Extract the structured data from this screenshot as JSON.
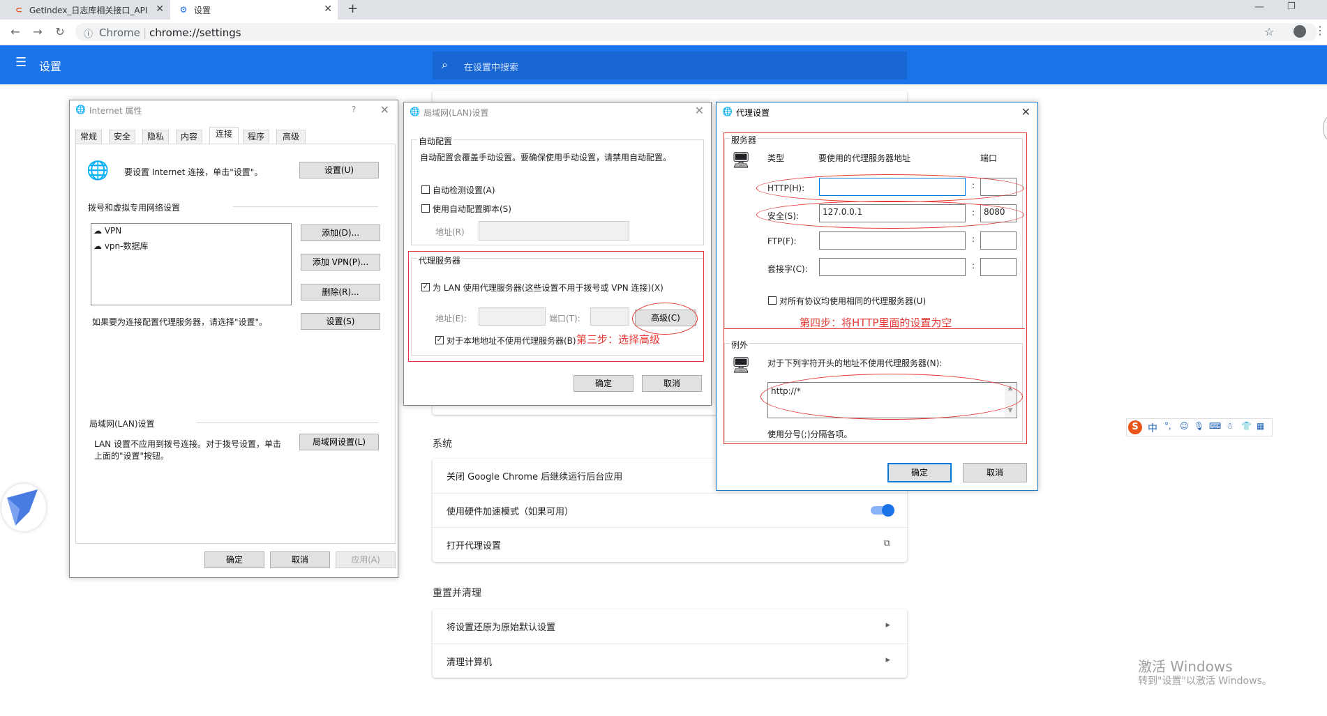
{
  "browser": {
    "tabs": [
      {
        "label": "GetIndex_日志库相关接口_API"
      },
      {
        "label": "设置"
      }
    ],
    "scheme_label": "Chrome",
    "url": "chrome://settings"
  },
  "settings": {
    "header_title": "设置",
    "search_placeholder": "在设置中搜索",
    "system_title": "系统",
    "system_items": [
      "关闭 Google Chrome 后继续运行后台应用",
      "使用硬件加速模式（如果可用）",
      "打开代理设置"
    ],
    "hw_accel_on": true,
    "reset_title": "重置并清理",
    "reset_items": [
      "将设置还原为原始默认设置",
      "清理计算机"
    ]
  },
  "inet": {
    "title": "Internet 属性",
    "help": "?",
    "tabs": [
      "常规",
      "安全",
      "隐私",
      "内容",
      "连接",
      "程序",
      "高级"
    ],
    "active_tab": "连接",
    "setup_text": "要设置 Internet 连接，单击\"设置\"。",
    "setup_btn": "设置(U)",
    "dialup_title": "拨号和虚拟专用网络设置",
    "connections": [
      "VPN",
      "vpn-数据库"
    ],
    "add_btn": "添加(D)...",
    "add_vpn_btn": "添加 VPN(P)...",
    "remove_btn": "删除(R)...",
    "settings_btn": "设置(S)",
    "proxy_hint": "如果要为连接配置代理服务器，请选择\"设置\"。",
    "lan_title": "局域网(LAN)设置",
    "lan_desc_1": "LAN 设置不应用到拨号连接。对于拨号设置，单击",
    "lan_desc_2": "上面的\"设置\"按钮。",
    "lan_btn": "局域网设置(L)",
    "ok": "确定",
    "cancel": "取消",
    "apply": "应用(A)"
  },
  "lan": {
    "title": "局域网(LAN)设置",
    "auto_title": "自动配置",
    "auto_desc": "自动配置会覆盖手动设置。要确保使用手动设置，请禁用自动配置。",
    "auto_detect": "自动检测设置(A)",
    "auto_script": "使用自动配置脚本(S)",
    "address_label": "地址(R)",
    "proxy_title": "代理服务器",
    "use_proxy": "为 LAN 使用代理服务器(这些设置不用于拨号或 VPN 连接)(X)",
    "addr_label": "地址(E):",
    "port_label": "端口(T):",
    "advanced_btn": "高级(C)",
    "bypass_local": "对于本地地址不使用代理服务器(B)",
    "step3": "第三步：选择高级",
    "ok": "确定",
    "cancel": "取消"
  },
  "proxy": {
    "title": "代理设置",
    "servers_title": "服务器",
    "col_type": "类型",
    "col_addr": "要使用的代理服务器地址",
    "col_port": "端口",
    "rows": [
      {
        "label": "HTTP(H):",
        "addr": "",
        "port": ""
      },
      {
        "label": "安全(S):",
        "addr": "127.0.0.1",
        "port": "8080"
      },
      {
        "label": "FTP(F):",
        "addr": "",
        "port": ""
      },
      {
        "label": "套接字(C):",
        "addr": "",
        "port": ""
      }
    ],
    "colon": ":",
    "same_proxy": "对所有协议均使用相同的代理服务器(U)",
    "step4": "第四步：将HTTP里面的设置为空",
    "except_title": "例外",
    "except_desc": "对于下列字符开头的地址不使用代理服务器(N):",
    "except_value": "http://*",
    "except_hint": "使用分号(;)分隔各项。",
    "ok": "确定",
    "cancel": "取消"
  },
  "ime": {
    "mode": "中"
  },
  "watermark": {
    "line1": "激活 Windows",
    "line2": "转到\"设置\"以激活 Windows。"
  }
}
